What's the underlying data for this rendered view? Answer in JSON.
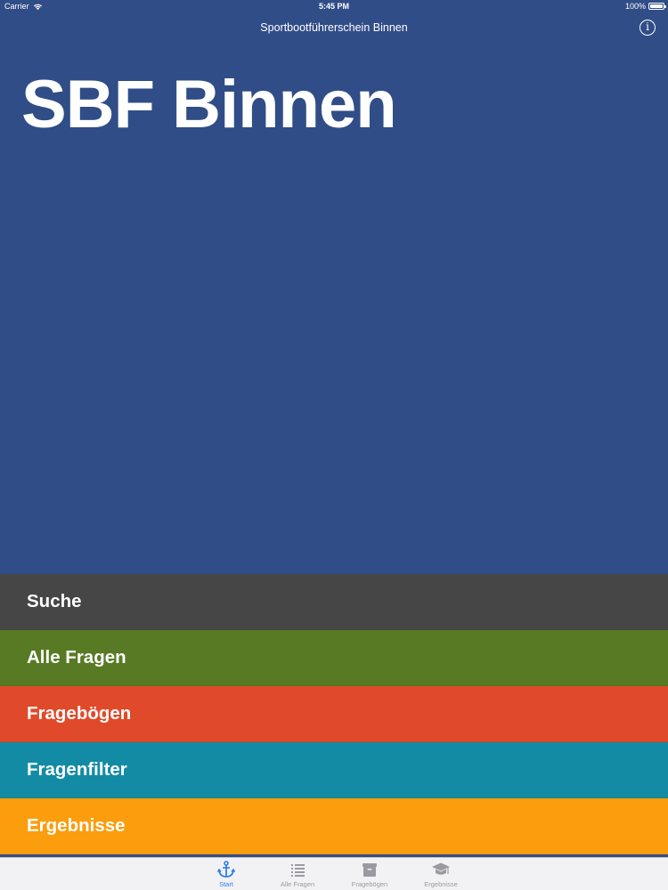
{
  "status_bar": {
    "carrier": "Carrier",
    "time": "5:45 PM",
    "battery_percent": "100%",
    "battery_level": 1.0
  },
  "nav": {
    "title": "Sportbootführerschein Binnen",
    "info_icon": "info-icon"
  },
  "hero": {
    "title": "SBF Binnen"
  },
  "menu": {
    "items": [
      {
        "label": "Suche",
        "color": "#464646"
      },
      {
        "label": "Alle Fragen",
        "color": "#587a24"
      },
      {
        "label": "Fragebögen",
        "color": "#e04a2b"
      },
      {
        "label": "Fragenfilter",
        "color": "#138ba4"
      },
      {
        "label": "Ergebnisse",
        "color": "#fb9d0c"
      }
    ]
  },
  "tabbar": {
    "tabs": [
      {
        "label": "Start",
        "icon": "anchor-icon",
        "active": true
      },
      {
        "label": "Alle Fragen",
        "icon": "list-icon",
        "active": false
      },
      {
        "label": "Fragebögen",
        "icon": "archive-box-icon",
        "active": false
      },
      {
        "label": "Ergebnisse",
        "icon": "graduation-cap-icon",
        "active": false
      }
    ]
  },
  "colors": {
    "background": "#314d87",
    "accent": "#2f7fe8",
    "tabbar_bg": "#f2f2f5"
  }
}
